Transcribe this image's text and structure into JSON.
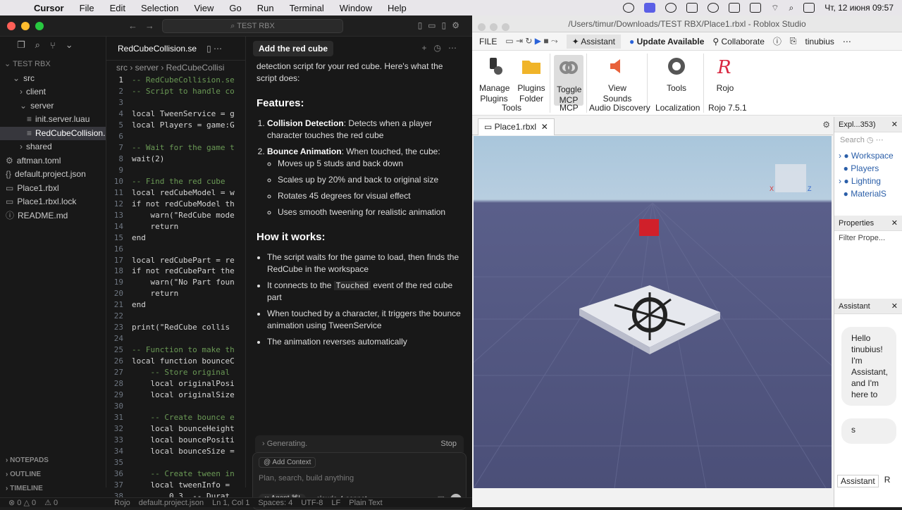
{
  "menubar": {
    "app": "Cursor",
    "items": [
      "File",
      "Edit",
      "Selection",
      "View",
      "Go",
      "Run",
      "Terminal",
      "Window",
      "Help"
    ],
    "clock": "Чт, 12 июня  09:57"
  },
  "cursor": {
    "search": "TEST RBX",
    "explorer": {
      "root": "TEST RBX",
      "items": [
        {
          "label": "src",
          "indent": 1,
          "type": "folder",
          "icon": "⌄"
        },
        {
          "label": "client",
          "indent": 2,
          "type": "folder",
          "icon": "›"
        },
        {
          "label": "server",
          "indent": 2,
          "type": "folder",
          "icon": "⌄"
        },
        {
          "label": "init.server.luau",
          "indent": 3,
          "type": "file",
          "icon": "≡"
        },
        {
          "label": "RedCubeCollision...",
          "indent": 3,
          "type": "file",
          "icon": "≡",
          "selected": true
        },
        {
          "label": "shared",
          "indent": 2,
          "type": "folder",
          "icon": "›"
        },
        {
          "label": "aftman.toml",
          "indent": 0,
          "type": "file",
          "icon": "⚙"
        },
        {
          "label": "default.project.json",
          "indent": 0,
          "type": "file",
          "icon": "{}"
        },
        {
          "label": "Place1.rbxl",
          "indent": 0,
          "type": "file",
          "icon": "▭"
        },
        {
          "label": "Place1.rbxl.lock",
          "indent": 0,
          "type": "file",
          "icon": "▭"
        },
        {
          "label": "README.md",
          "indent": 0,
          "type": "file",
          "icon": "ⓘ"
        }
      ],
      "bottom": [
        "NOTEPADS",
        "OUTLINE",
        "TIMELINE"
      ]
    },
    "editor": {
      "tab": "RedCubeCollision.se",
      "breadcrumb": "src › server › RedCubeCollisi",
      "lines": [
        "-- RedCubeCollision.se",
        "-- Script to handle co",
        "",
        "local TweenService = g",
        "local Players = game:G",
        "",
        "-- Wait for the game t",
        "wait(2)",
        "",
        "-- Find the red cube",
        "local redCubeModel = w",
        "if not redCubeModel th",
        "    warn(\"RedCube mode",
        "    return",
        "end",
        "",
        "local redCubePart = re",
        "if not redCubePart the",
        "    warn(\"No Part foun",
        "    return",
        "end",
        "",
        "print(\"RedCube collis",
        "",
        "-- Function to make th",
        "local function bounceC",
        "    -- Store original",
        "    local originalPosi",
        "    local originalSize",
        "",
        "    -- Create bounce e",
        "    local bounceHeight",
        "    local bouncePositi",
        "    local bounceSize =",
        "",
        "    -- Create tween in",
        "    local tweenInfo =",
        "        0.3, -- Durat"
      ]
    },
    "chat": {
      "tab": "Add the red cube",
      "intro": "detection script for your red cube. Here's what the script does:",
      "features_title": "Features:",
      "f1_b": "Collision Detection",
      "f1": ": Detects when a player character touches the red cube",
      "f2_b": "Bounce Animation",
      "f2": ": When touched, the cube:",
      "sub": [
        "Moves up 5 studs and back down",
        "Scales up by 20% and back to original size",
        "Rotates 45 degrees for visual effect",
        "Uses smooth tweening for realistic animation"
      ],
      "how_title": "How it works:",
      "h1": "The script waits for the game to load, then finds the RedCube in the workspace",
      "h2a": "It connects to the ",
      "h2code": "Touched",
      "h2b": " event of the red cube part",
      "h3": "When touched by a character, it triggers the bounce animation using TweenService",
      "h4": "The animation reverses automatically",
      "generating": "Generating.",
      "stop": "Stop",
      "add_context": "Add Context",
      "placeholder": "Plan, search, build anything",
      "agent": "∞ Agent ⌘I",
      "model": "claude-4-sonnet"
    },
    "status": [
      "⊗ 0 △ 0",
      "⚠ 0",
      "Rojo",
      "default.project.json",
      "Ln 1, Col 1",
      "Spaces: 4",
      "UTF-8",
      "LF",
      "Plain Text"
    ]
  },
  "roblox": {
    "title": "/Users/timur/Downloads/TEST RBX/Place1.rbxl - Roblox Studio",
    "menu": {
      "file": "FILE",
      "assistant": "Assistant",
      "update": "Update Available",
      "collaborate": "Collaborate",
      "user": "tinubius"
    },
    "ribbon": {
      "manage": "Manage\nPlugins",
      "folder": "Plugins\nFolder",
      "toggle": "Toggle\nMCP",
      "sounds": "View\nSounds",
      "tools_btn": "Tools",
      "rojo": "Rojo",
      "groups": [
        "Tools",
        "MCP",
        "Audio Discovery",
        "Localization",
        "Rojo 7.5.1"
      ]
    },
    "doc_tab": "Place1.rbxl",
    "explorer": {
      "title": "Expl...353)",
      "search": "Search",
      "items": [
        "Workspace",
        "Players",
        "Lighting",
        "MaterialS"
      ]
    },
    "properties": {
      "title": "Properties",
      "filter": "Filter Prope..."
    },
    "assistant": {
      "title": "Assistant",
      "greeting": "Hello tinubius! I'm Assistant, and I'm here to",
      "user_msg": "s",
      "tabs": [
        "Assistant",
        "R"
      ]
    }
  }
}
